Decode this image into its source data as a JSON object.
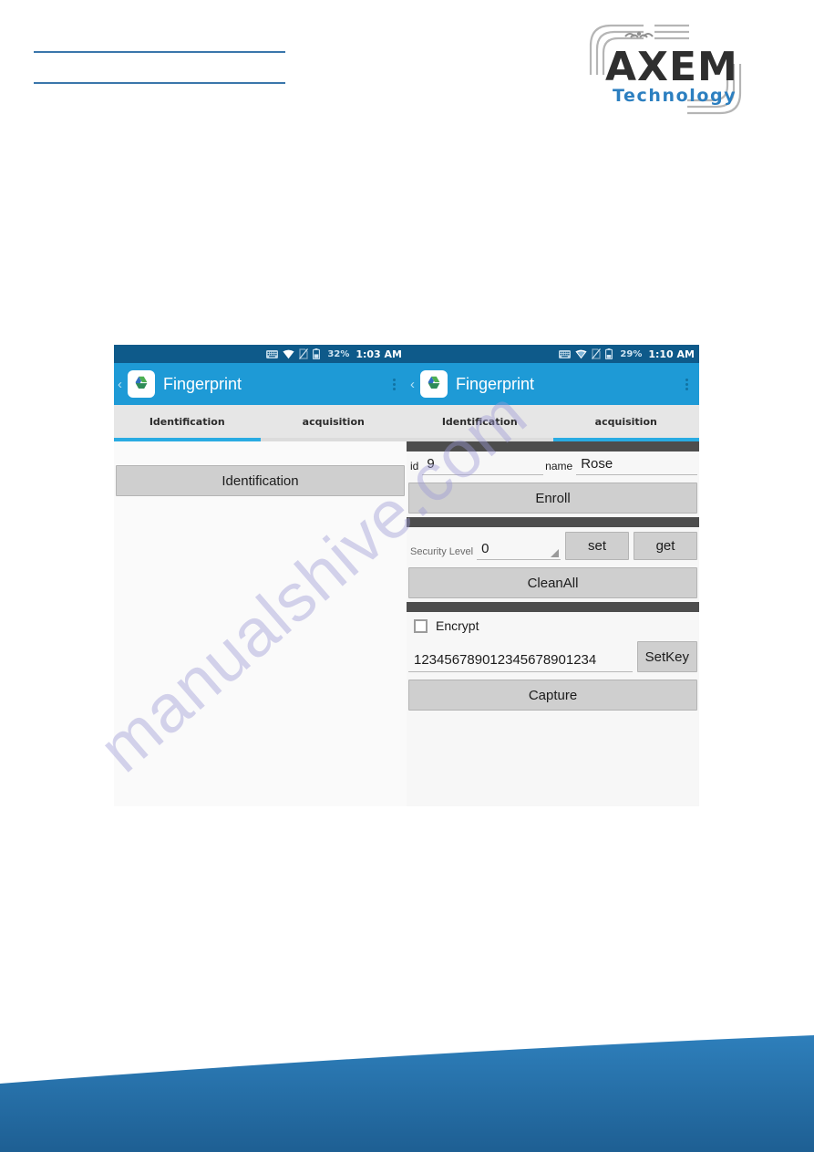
{
  "document": {
    "header_rules": 2,
    "logo": {
      "brand": "AXEM",
      "tagline": "Technology",
      "brand_color": "#2f2f2f",
      "tagline_color": "#2c7fc0",
      "arc_color": "#b5b5b5"
    },
    "footer": {
      "wave_color": "#2a7ab5"
    },
    "rule_color": "#3a76ab",
    "watermark": "manualshive.com"
  },
  "screenshots": [
    {
      "id": "left",
      "statusbar": {
        "icons": [
          "keyboard-icon",
          "wifi-icon",
          "no-sim-icon",
          "battery-icon"
        ],
        "battery_percent": "32%",
        "time": "1:03 AM"
      },
      "actionbar": {
        "back": "‹",
        "app_icon": "fingerprint-app-icon",
        "title": "Fingerprint",
        "overflow": "overflow-menu-icon"
      },
      "tabs": [
        {
          "label": "Identification",
          "selected": true
        },
        {
          "label": "acquisition",
          "selected": false
        }
      ],
      "buttons": [
        {
          "label": "Identification"
        }
      ]
    },
    {
      "id": "right",
      "statusbar": {
        "icons": [
          "keyboard-icon",
          "wifi-icon",
          "no-sim-icon",
          "battery-icon"
        ],
        "battery_percent": "29%",
        "time": "1:10 AM"
      },
      "actionbar": {
        "back": "‹",
        "app_icon": "fingerprint-app-icon",
        "title": "Fingerprint",
        "overflow": "overflow-menu-icon"
      },
      "tabs": [
        {
          "label": "Identification",
          "selected": false
        },
        {
          "label": "acquisition",
          "selected": true
        }
      ],
      "form": {
        "id_label": "id",
        "id_value": "9",
        "name_label": "name",
        "name_value": "Rose",
        "enroll_label": "Enroll",
        "security_level_label": "Security Level",
        "security_level_value": "0",
        "set_label": "set",
        "get_label": "get",
        "cleanall_label": "CleanAll",
        "encrypt_label": "Encrypt",
        "encrypt_checked": false,
        "key_value": "123456789012345678901234",
        "setkey_label": "SetKey",
        "capture_label": "Capture"
      }
    }
  ]
}
